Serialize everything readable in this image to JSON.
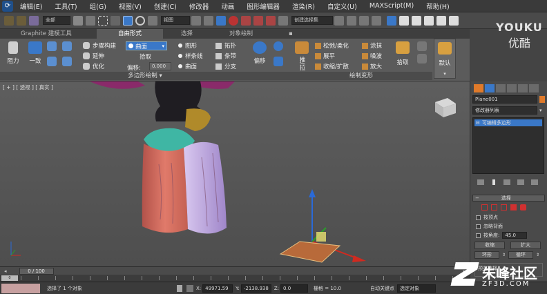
{
  "menu": {
    "items": [
      "编辑(E)",
      "工具(T)",
      "组(G)",
      "视图(V)",
      "创建(C)",
      "修改器",
      "动画",
      "图形编辑器",
      "渲染(R)",
      "自定义(U)",
      "MAXScript(M)",
      "帮助(H)"
    ]
  },
  "toolbar": {
    "selection_filter": "全部",
    "coordinate_system": "视图",
    "named_selection_placeholder": "创建选择集"
  },
  "ribbon": {
    "tabs": [
      "Graphite 建模工具",
      "自由形式",
      "选择",
      "对象绘制"
    ],
    "active_tab": 1,
    "polydraw": {
      "resistance_label": "阻力",
      "conform_label": "一致",
      "step_build": "步骤构建",
      "extend": "延伸",
      "optimize": "优化",
      "surface_dropdown": "曲面",
      "pick_label": "拾取",
      "offset_label": "偏移:",
      "offset_value": "0.000",
      "shapes": "图形",
      "splines": "样条线",
      "surface_radio": "曲面",
      "topology": "拓扑",
      "strips": "条带",
      "branches": "分支",
      "group_title": "多边形绘制"
    },
    "paint_deform": {
      "offset_btn": "偏移",
      "push_pull": "推/拉",
      "relax_soften": "松弛/柔化",
      "flatten": "展平",
      "shrink_expand": "收缩/扩散",
      "smudge": "涂抹",
      "noise": "噪波",
      "amplify": "放大",
      "pick": "拾取",
      "default": "默认",
      "group_title": "绘制变形"
    }
  },
  "viewport": {
    "label": "[ + ] [ 透视 ] [ 真实 ]"
  },
  "command_panel": {
    "object_name": "Plane001",
    "modifier_list": "修改器列表",
    "stack_item": "可编辑多边形",
    "rollout_selection": "选择",
    "by_vertex": "按顶点",
    "ignore_backfacing": "忽略背面",
    "by_angle": "按角度:",
    "angle_value": "45.0",
    "shrink": "收缩",
    "grow": "扩大",
    "ring": "环形",
    "loop": "循环",
    "preview_selection": "预览选择"
  },
  "timeline": {
    "frame": "0 / 100"
  },
  "status": {
    "selected": "选择了 1 个对象",
    "x_label": "X:",
    "x_value": "49971.59",
    "y_label": "Y:",
    "y_value": "-2138.938",
    "z_label": "Z:",
    "z_value": "0.0",
    "grid": "栅格 = 10.0",
    "auto_key": "自动关键点",
    "selected_dropdown": "选定对象"
  },
  "watermarks": {
    "youku": "YOUKU",
    "youku_cn": "优酷",
    "zf3d": "朱峰社区",
    "zf3d_url": "ZF3D.COM"
  },
  "colors": {
    "accent_blue": "#3a78c8",
    "selection_red": "#d03030",
    "gizmo_y": "#2a6ad8",
    "gizmo_x": "#d02a20",
    "gizmo_z": "#28a028"
  }
}
